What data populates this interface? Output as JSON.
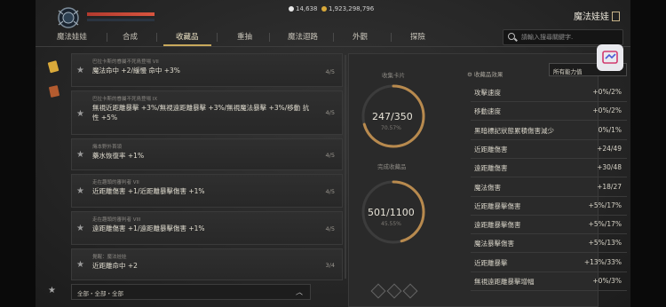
{
  "header": {
    "currency_gems": "14,638",
    "currency_gold": "1,923,298,796",
    "character_name": "魔法娃娃"
  },
  "tabs": [
    "魔法娃娃",
    "合成",
    "收藏品",
    "重抽",
    "魔法迴路",
    "外觀",
    "探險"
  ],
  "active_tab": "收藏品",
  "search": {
    "placeholder": "請輸入搜尋關鍵字."
  },
  "collections": [
    {
      "sub": "巴拉卡斯的眷屬不死鳥登場 VII",
      "main": "魔法命中 +2/緩慢 命中 +3%",
      "count": "4/5"
    },
    {
      "sub": "巴拉卡斯的眷屬不死鳥登場 IX",
      "main": "無視近距離暴擊 +3%/無視遠距離暴擊 +3%/無視魔法暴擊 +3%/移動 抗性 +5%",
      "count": "4/5"
    },
    {
      "sub": "熾本野外首領",
      "main": "藥水恢復率 +1%",
      "count": "4/5"
    },
    {
      "sub": "走在趣頭的審判者 VII",
      "main": "近距離傷害 +1/近距離暴擊傷害 +1%",
      "count": "4/5"
    },
    {
      "sub": "走在趣頭的審判者 VIII",
      "main": "遠距離傷害 +1/遠距離暴擊傷害 +1%",
      "count": "4/5"
    },
    {
      "sub": "覺醒：魔法娃娃",
      "main": "近距離命中 +2",
      "count": "3/4"
    }
  ],
  "filter_label": "全部・全部・全部",
  "progress": {
    "collect_label": "收集卡片",
    "collect_value": "247/350",
    "collect_pct": "70.57%",
    "collect_ratio": 0.7057,
    "done_label": "完成收藏品",
    "done_value": "501/1100",
    "done_pct": "45.55%",
    "done_ratio": 0.4555
  },
  "stats_header": "收藏品效果",
  "stats_filter": "所有能力值",
  "stats": [
    {
      "name": "攻擊速度",
      "value": "+0%/2%"
    },
    {
      "name": "移動速度",
      "value": "+0%/2%"
    },
    {
      "name": "黑暗標記狀態累積傷害減少",
      "value": "0%/1%"
    },
    {
      "name": "近距離傷害",
      "value": "+24/49"
    },
    {
      "name": "遠距離傷害",
      "value": "+30/48"
    },
    {
      "name": "魔法傷害",
      "value": "+18/27"
    },
    {
      "name": "近距離暴擊傷害",
      "value": "+5%/17%"
    },
    {
      "name": "遠距離暴擊傷害",
      "value": "+5%/17%"
    },
    {
      "name": "魔法暴擊傷害",
      "value": "+5%/13%"
    },
    {
      "name": "近距離暴擊",
      "value": "+13%/33%"
    },
    {
      "name": "無視遠距離暴擊增幅",
      "value": "+0%/3%"
    }
  ]
}
